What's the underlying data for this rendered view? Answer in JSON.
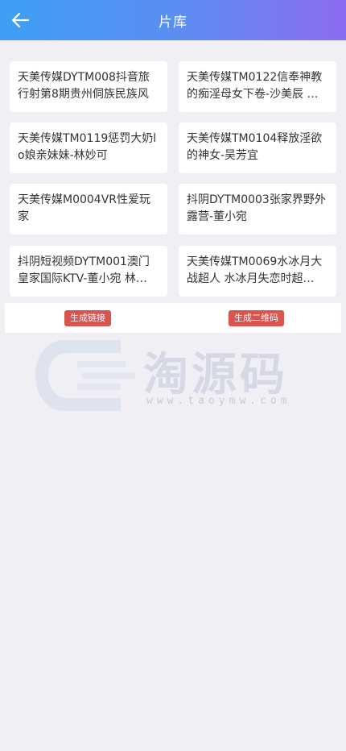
{
  "header": {
    "title": "片库",
    "back_icon": "arrow-left-icon"
  },
  "videos": [
    "天美传媒DYTM008抖音旅行射第8期贵州侗族民族风",
    "天美传媒TM0122信奉神教的痴淫母女下卷-沙美辰 …",
    "天美传媒TM0119惩罚大奶lo娘亲妹妹-林妙可",
    "天美传媒TM0104释放淫欲的神女-吴芳宜",
    "天美传媒M0004VR性爱玩家",
    "抖阴DYTM0003张家界野外露营-董小宛",
    "抖阴短视频DYTM001澳门皇家国际KTV-董小宛 林…",
    "天美传媒TM0069水冰月大战超人 水冰月失恋时超…"
  ],
  "actions": {
    "generate_link": "生成链接",
    "generate_qrcode": "生成二维码",
    "button_color": "#d9534f"
  },
  "watermark": {
    "text": "淘源码",
    "url": "www.taoymw.com"
  },
  "colors": {
    "header_start": "#3f9ff5",
    "header_end": "#8c6bf0",
    "background": "#f0eff4",
    "card": "#ffffff",
    "text": "#333333"
  }
}
